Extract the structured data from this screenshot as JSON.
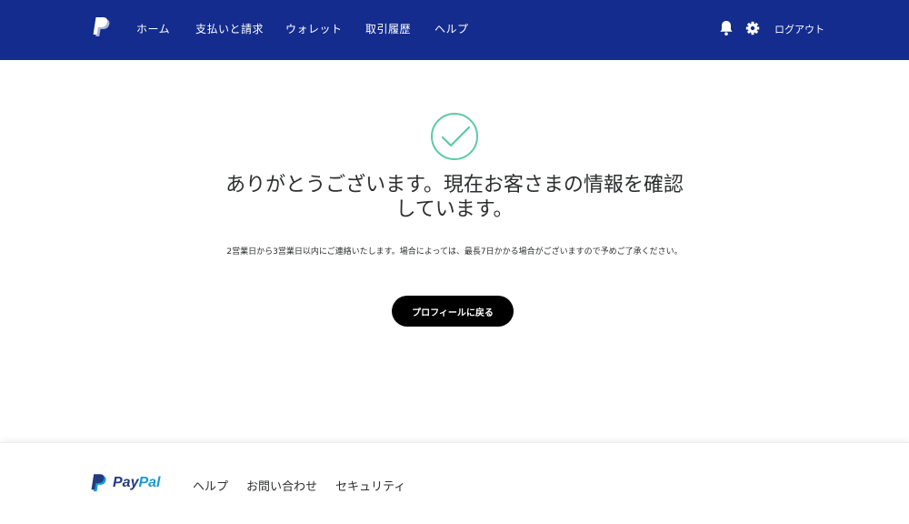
{
  "header": {
    "nav": [
      "ホーム",
      "支払いと請求",
      "ウォレット",
      "取引履歴",
      "ヘルプ"
    ],
    "logout": "ログアウト"
  },
  "main": {
    "headline_line1": "ありがとうございます。現在お客さまの情報を確認",
    "headline_line2": "しています。",
    "subtext": "2営業日から3営業日以内にご連絡いたします。場合によっては、最長7日かかる場合がございますので予めご了承ください。",
    "button": "プロフィールに戻る"
  },
  "footer": {
    "brand_pay": "Pay",
    "brand_pal": "Pal",
    "links": [
      "ヘルプ",
      "お問い合わせ",
      "セキュリティ"
    ]
  },
  "colors": {
    "header_bg": "#142c8e",
    "check": "#5cc9a7",
    "button_bg": "#000000"
  }
}
